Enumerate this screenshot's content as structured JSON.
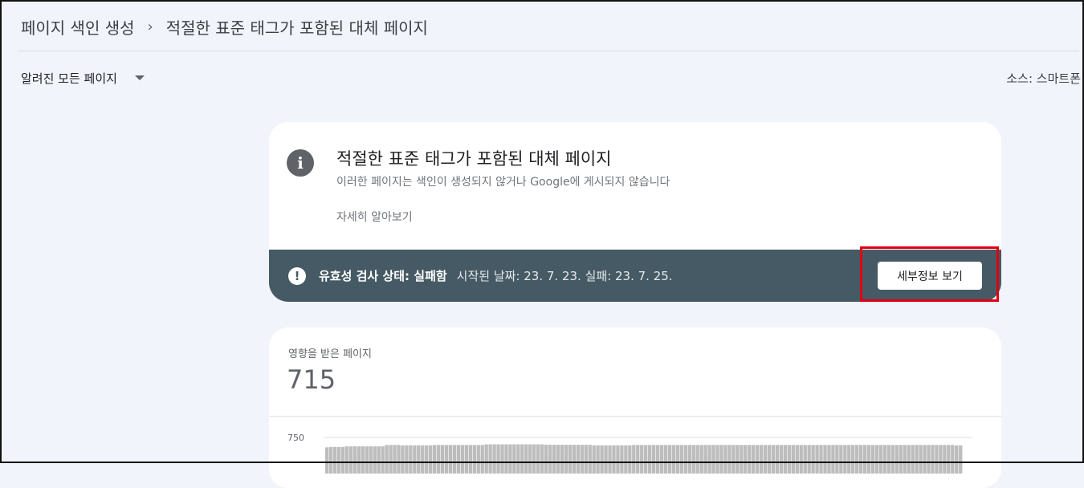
{
  "breadcrumb": {
    "parent": "페이지 색인 생성",
    "separator": "›",
    "current": "적절한 표준 태그가 포함된 대체 페이지"
  },
  "filter": {
    "selected": "알려진 모든 페이지"
  },
  "source": {
    "label": "소스: 스마트폰"
  },
  "issue_card": {
    "icon": "info-icon",
    "title": "적절한 표준 태그가 포함된 대체 페이지",
    "subtitle": "이러한 페이지는 색인이 생성되지 않거나 Google에 게시되지 않습니다",
    "learn_more": "자세히 알아보기"
  },
  "validation": {
    "icon": "alert-icon",
    "label": "유효성 검사 상태: 실패함",
    "dates": "시작된 날짜: 23. 7. 23.   실패: 23. 7. 25.",
    "details_button": "세부정보 보기"
  },
  "affected": {
    "label": "영향을 받은 페이지",
    "value": "715"
  },
  "chart_data": {
    "type": "bar",
    "y_tick": "750",
    "ylim": [
      0,
      750
    ],
    "color": "#bdbdbd",
    "values": [
      700,
      702,
      702,
      702,
      702,
      705,
      705,
      705,
      705,
      705,
      705,
      705,
      705,
      705,
      705,
      712,
      712,
      712,
      712,
      710,
      710,
      710,
      710,
      710,
      710,
      710,
      710,
      712,
      712,
      712,
      712,
      712,
      712,
      712,
      712,
      712,
      712,
      712,
      712,
      712,
      715,
      715,
      715,
      715,
      715,
      715,
      715,
      715,
      715,
      715,
      715,
      715,
      715,
      715,
      715,
      713,
      713,
      713,
      713,
      713,
      713,
      713,
      713,
      713,
      713,
      713,
      713,
      710,
      710,
      710,
      710,
      710,
      710,
      710,
      710,
      710,
      710,
      712,
      712,
      712,
      712,
      712,
      712,
      712,
      712,
      712,
      712,
      712,
      712,
      712,
      712,
      712,
      712,
      712,
      712,
      712,
      712,
      712,
      712,
      712,
      712,
      712,
      712,
      712,
      712,
      712,
      712,
      712,
      712,
      712,
      712,
      712,
      712,
      712,
      712,
      712,
      712,
      712,
      712,
      712,
      712,
      712,
      712,
      712,
      712,
      712,
      712,
      712,
      712,
      712,
      712,
      712,
      712,
      712,
      712,
      712,
      712,
      712,
      712,
      712,
      712,
      712,
      712,
      712,
      712,
      712,
      712,
      712,
      712,
      712,
      712,
      712,
      712,
      712,
      712,
      712,
      712,
      712,
      710,
      710
    ]
  }
}
